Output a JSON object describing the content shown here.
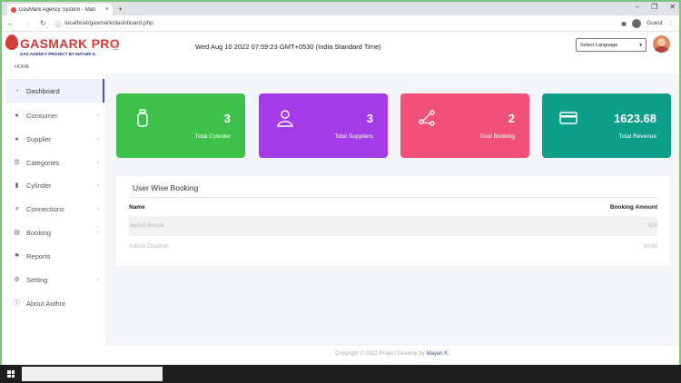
{
  "browser": {
    "tab_title": "GasMark Agency System - Man",
    "url": "localhost/gasmark/dashboard.php",
    "profile": "Guest",
    "new_tab": "+",
    "close": "×"
  },
  "header": {
    "logo_main": "GASMARK",
    "logo_pro": "PRO",
    "logo_sub": "GAS AGENCY PROJECT BY MAYURI K.",
    "home": "HOME",
    "datetime": "Wed Aug 10 2022 07:59:23 GMT+0530 (India Standard Time)",
    "language_select": "Select Language"
  },
  "sidebar": {
    "items": [
      {
        "label": "Dashboard",
        "icon": "speedometer-icon",
        "chevron": false
      },
      {
        "label": "Consumer",
        "icon": "user-icon",
        "chevron": true
      },
      {
        "label": "Supplier",
        "icon": "users-icon",
        "chevron": true
      },
      {
        "label": "Categories",
        "icon": "list-icon",
        "chevron": true
      },
      {
        "label": "Cylinder",
        "icon": "cylinder-icon",
        "chevron": true
      },
      {
        "label": "Connections",
        "icon": "connections-icon",
        "chevron": true
      },
      {
        "label": "Booking",
        "icon": "booking-icon",
        "chevron": true
      },
      {
        "label": "Reports",
        "icon": "flag-icon",
        "chevron": false
      },
      {
        "label": "Setting",
        "icon": "gear-icon",
        "chevron": true
      },
      {
        "label": "About Author",
        "icon": "info-icon",
        "chevron": false
      }
    ]
  },
  "cards": [
    {
      "value": "3",
      "label": "Total Cylinder",
      "color": "#3ec14a",
      "icon": "cylinder-icon"
    },
    {
      "value": "3",
      "label": "Total Suppliers",
      "color": "#a43be8",
      "icon": "user-outline-icon"
    },
    {
      "value": "2",
      "label": "Total Booking",
      "color": "#f2517a",
      "icon": "share-icon"
    },
    {
      "value": "1623.68",
      "label": "Total Revenue",
      "color": "#0e9f8a",
      "icon": "credit-card-icon"
    }
  ],
  "booking_table": {
    "title": "User Wise Booking",
    "columns": [
      "Name",
      "Booking Amount"
    ],
    "rows": [
      {
        "name": "Jayesh Bhosle",
        "amount": "500"
      },
      {
        "name": "Ashish Chauhan",
        "amount": "80.68"
      }
    ]
  },
  "footer": {
    "text": "Copyright © 2022 Project Develop by",
    "author": "Mayuri K."
  }
}
